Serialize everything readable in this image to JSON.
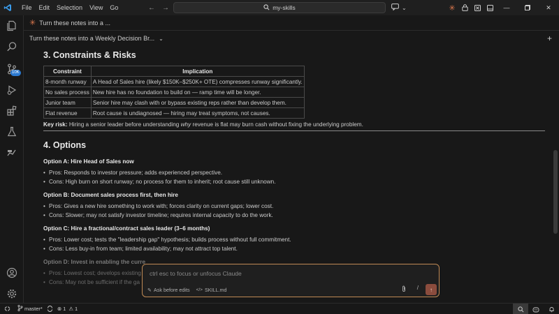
{
  "menu": [
    "File",
    "Edit",
    "Selection",
    "View",
    "Go"
  ],
  "search": {
    "text": "my-skills"
  },
  "tab": {
    "label": "Turn these notes into a ..."
  },
  "session": {
    "title": "Turn these notes into a Weekly Decision Br..."
  },
  "activity": {
    "badge": "10K"
  },
  "section3": {
    "heading": "3. Constraints & Risks",
    "headers": [
      "Constraint",
      "Implication"
    ],
    "rows": [
      [
        "8-month runway",
        "A Head of Sales hire (likely $150K–$250K+ OTE) compresses runway significantly."
      ],
      [
        "No sales process",
        "New hire has no foundation to build on — ramp time will be longer."
      ],
      [
        "Junior team",
        "Senior hire may clash with or bypass existing reps rather than develop them."
      ],
      [
        "Flat revenue",
        "Root cause is undiagnosed — hiring may treat symptoms, not causes."
      ]
    ],
    "key_risk_label": "Key risk:",
    "key_risk_pre": " Hiring a senior leader before understanding ",
    "key_risk_em": "why",
    "key_risk_post": " revenue is flat may burn cash without fixing the underlying problem."
  },
  "section4": {
    "heading": "4. Options",
    "options": [
      {
        "title": "Option A: Hire Head of Sales now",
        "bullets": [
          "Pros: Responds to investor pressure; adds experienced perspective.",
          "Cons: High burn on short runway; no process for them to inherit; root cause still unknown."
        ]
      },
      {
        "title": "Option B: Document sales process first, then hire",
        "bullets": [
          "Pros: Gives a new hire something to work with; forces clarity on current gaps; lower cost.",
          "Cons: Slower; may not satisfy investor timeline; requires internal capacity to do the work."
        ]
      },
      {
        "title": "Option C: Hire a fractional/contract sales leader (3–6 months)",
        "bullets": [
          "Pros: Lower cost; tests the \"leadership gap\" hypothesis; builds process without full commitment.",
          "Cons: Less buy-in from team; limited availability; may not attract top talent."
        ]
      },
      {
        "title": "Option D: Invest in enabling the curre",
        "bullets": [
          "Pros: Lowest cost; develops existing",
          "Cons: May not be sufficient if the ga"
        ]
      }
    ]
  },
  "prompt": {
    "placeholder": "ctrl esc to focus or unfocus Claude",
    "mode": "Ask before edits",
    "file": "SKILL.md",
    "slash": "/"
  },
  "status": {
    "branch": "master*",
    "errors": "1",
    "warnings": "1"
  }
}
